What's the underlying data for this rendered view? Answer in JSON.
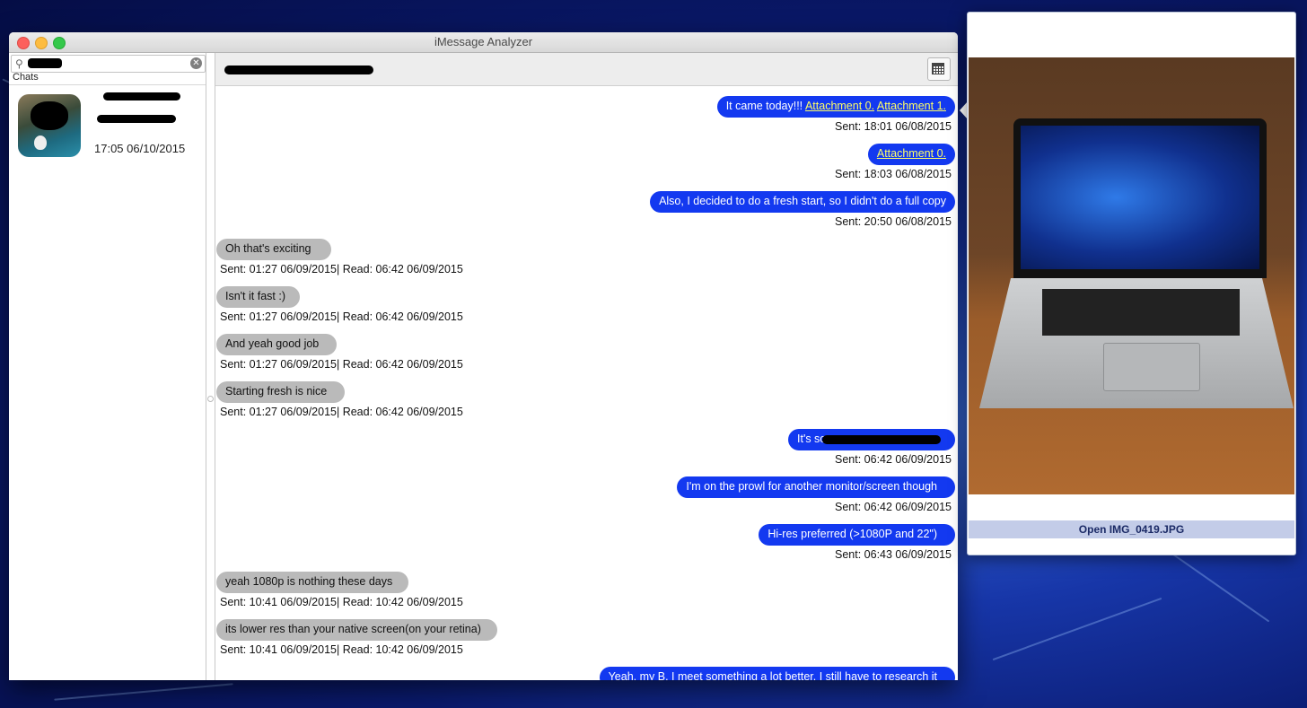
{
  "window": {
    "title": "iMessage Analyzer"
  },
  "sidebar": {
    "section_label": "Chats",
    "chats": [
      {
        "date": "17:05 06/10/2015"
      }
    ]
  },
  "messages": [
    {
      "type": "sent",
      "text": "It came today!!! ",
      "attachments": [
        "Attachment 0.",
        "Attachment 1."
      ],
      "meta": "Sent: 18:01 06/08/2015"
    },
    {
      "type": "sent",
      "text": "",
      "attachments": [
        "Attachment 0."
      ],
      "meta": "Sent: 18:03 06/08/2015"
    },
    {
      "type": "sent",
      "text": "Also, I decided to do a fresh start, so I didn't do a full copy",
      "meta": "Sent: 20:50 06/08/2015"
    },
    {
      "type": "recv",
      "text": "Oh that's exciting",
      "meta": "Sent: 01:27 06/09/2015| Read: 06:42 06/09/2015"
    },
    {
      "type": "recv",
      "text": "Isn't it fast :)",
      "meta": "Sent: 01:27 06/09/2015| Read: 06:42 06/09/2015"
    },
    {
      "type": "recv",
      "text": "And yeah good job",
      "meta": "Sent: 01:27 06/09/2015| Read: 06:42 06/09/2015"
    },
    {
      "type": "recv",
      "text": "Starting fresh is nice",
      "meta": "Sent: 01:27 06/09/2015| Read: 06:42 06/09/2015"
    },
    {
      "type": "sent",
      "text": "It's so",
      "meta": "Sent: 06:42 06/09/2015"
    },
    {
      "type": "sent",
      "text": "I'm on the prowl for another monitor/screen though",
      "meta": "Sent: 06:42 06/09/2015"
    },
    {
      "type": "sent",
      "text": "Hi-res preferred (>1080P and 22\")",
      "meta": "Sent: 06:43 06/09/2015"
    },
    {
      "type": "recv",
      "text": "yeah 1080p is nothing these days",
      "meta": "Sent: 10:41 06/09/2015| Read: 10:42 06/09/2015"
    },
    {
      "type": "recv",
      "text": "its lower res than your native screen(on your retina)",
      "meta": "Sent: 10:41 06/09/2015| Read: 10:42 06/09/2015"
    },
    {
      "type": "sent",
      "text": "Yeah, my B. I meet something a lot better. I still have to research it",
      "meta": ""
    }
  ],
  "popover": {
    "open_button": "Open IMG_0419.JPG"
  }
}
